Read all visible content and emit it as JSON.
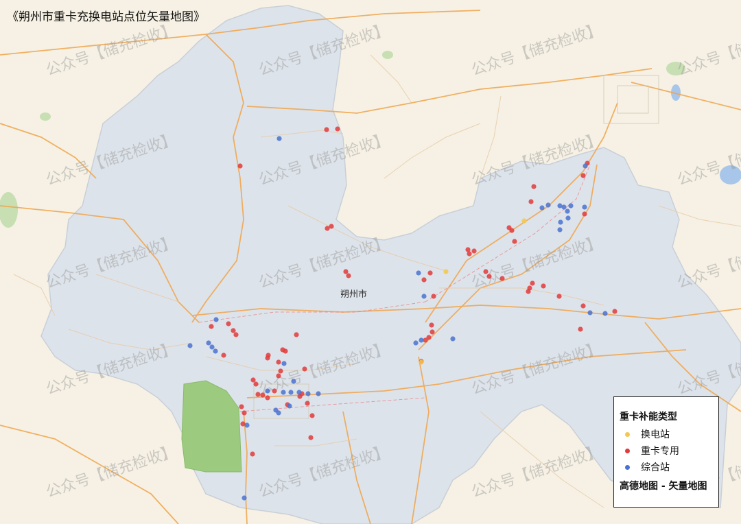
{
  "title": "《朔州市重卡充换电站点位矢量地图》",
  "city_label": "朔州市",
  "watermark": "公众号【储充检收】",
  "legend": {
    "title": "重卡补能类型",
    "items": [
      {
        "label": "换电站",
        "color": "#f3c84d"
      },
      {
        "label": "重卡专用",
        "color": "#e23b3b"
      },
      {
        "label": "综合站",
        "color": "#4a72d0"
      }
    ],
    "source": "高德地图 - 矢量地图"
  },
  "colors": {
    "background": "#f6f1e4",
    "region": "#dde3ea",
    "park": "#9ccb7f",
    "water": "#a8c6ea",
    "road_major": "#f0a44b",
    "road_minor": "#d9cdb8"
  },
  "points": {
    "heavy": [
      [
        476,
        189
      ],
      [
        492,
        188
      ],
      [
        350,
        242
      ],
      [
        477,
        333
      ],
      [
        483,
        330
      ],
      [
        308,
        476
      ],
      [
        333,
        472
      ],
      [
        340,
        482
      ],
      [
        344,
        488
      ],
      [
        326,
        518
      ],
      [
        390,
        522
      ],
      [
        412,
        510
      ],
      [
        416,
        512
      ],
      [
        444,
        538
      ],
      [
        369,
        554
      ],
      [
        373,
        560
      ],
      [
        390,
        580
      ],
      [
        406,
        548
      ],
      [
        437,
        578
      ],
      [
        440,
        574
      ],
      [
        448,
        588
      ],
      [
        419,
        590
      ],
      [
        352,
        593
      ],
      [
        356,
        602
      ],
      [
        354,
        618
      ],
      [
        455,
        606
      ],
      [
        453,
        638
      ],
      [
        368,
        662
      ],
      [
        504,
        396
      ],
      [
        508,
        402
      ],
      [
        682,
        364
      ],
      [
        684,
        370
      ],
      [
        691,
        366
      ],
      [
        742,
        332
      ],
      [
        746,
        336
      ],
      [
        750,
        352
      ],
      [
        778,
        272
      ],
      [
        774,
        294
      ],
      [
        708,
        396
      ],
      [
        713,
        403
      ],
      [
        732,
        406
      ],
      [
        770,
        425
      ],
      [
        772,
        420
      ],
      [
        776,
        413
      ],
      [
        792,
        417
      ],
      [
        815,
        432
      ],
      [
        850,
        446
      ],
      [
        846,
        480
      ],
      [
        896,
        454
      ],
      [
        850,
        256
      ],
      [
        856,
        238
      ],
      [
        852,
        312
      ],
      [
        627,
        398
      ],
      [
        618,
        408
      ],
      [
        632,
        432
      ],
      [
        629,
        474
      ],
      [
        630,
        484
      ],
      [
        625,
        492
      ],
      [
        620,
        496
      ],
      [
        614,
        527
      ],
      [
        383,
        576
      ],
      [
        400,
        570
      ],
      [
        406,
        528
      ],
      [
        432,
        488
      ],
      [
        391,
        518
      ],
      [
        409,
        541
      ],
      [
        376,
        575
      ]
    ],
    "integrated": [
      [
        407,
        202
      ],
      [
        315,
        466
      ],
      [
        277,
        504
      ],
      [
        304,
        500
      ],
      [
        314,
        512
      ],
      [
        309,
        506
      ],
      [
        414,
        530
      ],
      [
        428,
        556
      ],
      [
        413,
        572
      ],
      [
        424,
        572
      ],
      [
        449,
        574
      ],
      [
        464,
        574
      ],
      [
        422,
        592
      ],
      [
        402,
        598
      ],
      [
        406,
        602
      ],
      [
        610,
        398
      ],
      [
        618,
        432
      ],
      [
        606,
        500
      ],
      [
        614,
        496
      ],
      [
        660,
        494
      ],
      [
        360,
        620
      ],
      [
        356,
        726
      ],
      [
        790,
        303
      ],
      [
        799,
        299
      ],
      [
        816,
        300
      ],
      [
        822,
        302
      ],
      [
        832,
        300
      ],
      [
        827,
        308
      ],
      [
        852,
        302
      ],
      [
        817,
        324
      ],
      [
        816,
        335
      ],
      [
        828,
        318
      ],
      [
        860,
        456
      ],
      [
        882,
        457
      ],
      [
        853,
        242
      ],
      [
        390,
        570
      ],
      [
        436,
        572
      ]
    ],
    "swap": [
      [
        650,
        396
      ],
      [
        764,
        322
      ],
      [
        614,
        528
      ]
    ]
  }
}
